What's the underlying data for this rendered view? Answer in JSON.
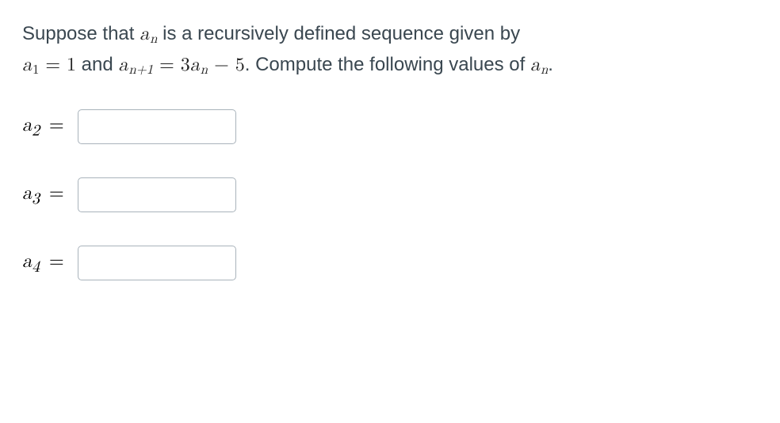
{
  "prompt": {
    "part1": "Suppose that ",
    "an_var_a": "a",
    "an_var_n": "n",
    "part2": " is a recursively defined sequence given by ",
    "a1_a": "a",
    "a1_sub": "1",
    "eq1": " = 1",
    "and": " and ",
    "anp1_a": "a",
    "anp1_sub": "n+1",
    "eq2": " = 3",
    "an2_a": "a",
    "an2_sub": "n",
    "minus5": " − 5",
    "part3": ". Compute the following values of ",
    "an3_a": "a",
    "an3_sub": "n",
    "period": "."
  },
  "rows": [
    {
      "a": "a",
      "sub": "2",
      "eq": " =",
      "value": ""
    },
    {
      "a": "a",
      "sub": "3",
      "eq": " =",
      "value": ""
    },
    {
      "a": "a",
      "sub": "4",
      "eq": " =",
      "value": ""
    }
  ]
}
